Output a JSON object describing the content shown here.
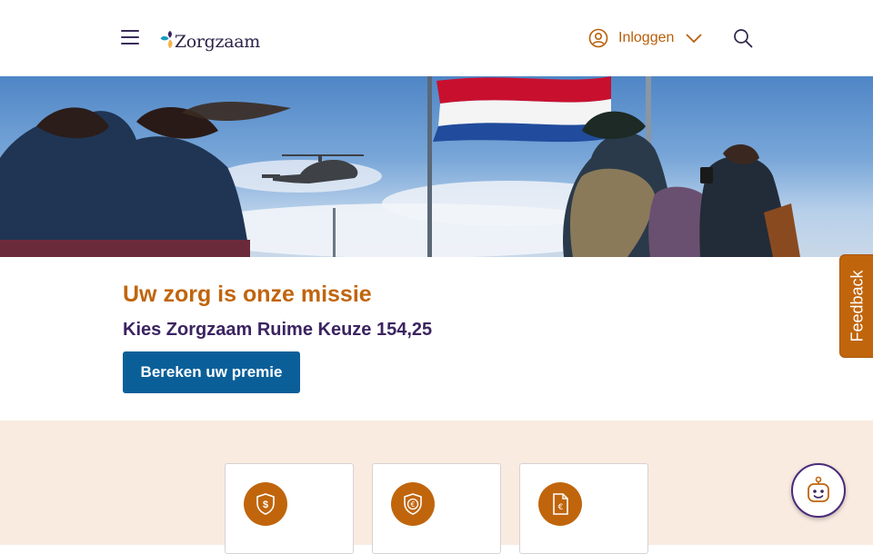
{
  "header": {
    "logo_text": "Zorgzaam",
    "login_label": "Inloggen",
    "icons": [
      "menu-icon",
      "logo-icon",
      "user-icon",
      "chevron-down-icon",
      "search-icon"
    ]
  },
  "intro": {
    "title": "Uw zorg is onze missie",
    "subtitle": "Kies Zorgzaam Ruime Keuze 154,25",
    "cta_label": "Bereken uw premie"
  },
  "cards": [
    {
      "icon": "shield-dollar-icon"
    },
    {
      "icon": "shield-euro-icon"
    },
    {
      "icon": "document-euro-icon"
    }
  ],
  "feedback_label": "Feedback",
  "colors": {
    "accent_orange": "#c0650c",
    "brand_purple": "#3b2461",
    "button_blue": "#0b5f99",
    "band_background": "#f9ebe0"
  }
}
